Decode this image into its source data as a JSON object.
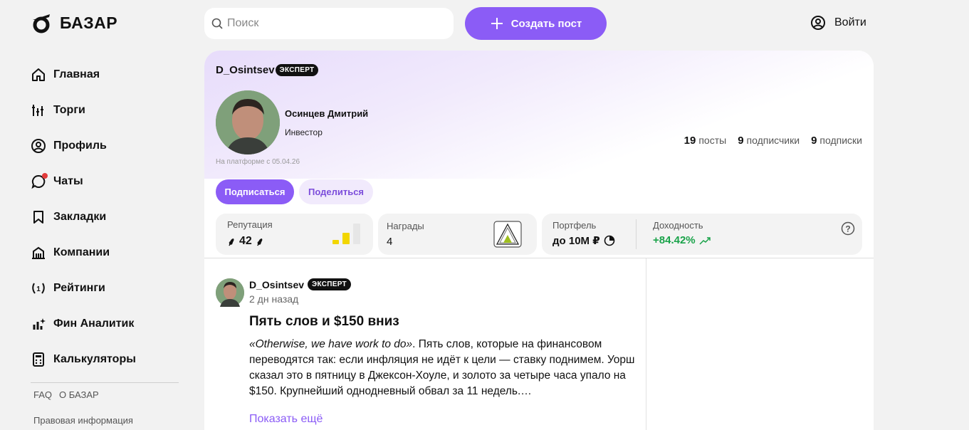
{
  "brand": {
    "name": "БАЗАР"
  },
  "nav": [
    {
      "label": "Главная",
      "icon": "home-icon"
    },
    {
      "label": "Торги",
      "icon": "trades-icon"
    },
    {
      "label": "Профиль",
      "icon": "user-icon"
    },
    {
      "label": "Чаты",
      "icon": "chat-icon"
    },
    {
      "label": "Закладки",
      "icon": "bookmark-icon"
    },
    {
      "label": "Компании",
      "icon": "building-icon"
    },
    {
      "label": "Рейтинги",
      "icon": "laurel-icon"
    },
    {
      "label": "Фин Аналитик",
      "icon": "analytics-icon"
    },
    {
      "label": "Калькуляторы",
      "icon": "calculator-icon"
    }
  ],
  "footer": {
    "faq": "FAQ",
    "about": "О БАЗАР",
    "legal": "Правовая информация"
  },
  "header": {
    "search_placeholder": "Поиск",
    "create_label": "Создать пост",
    "login_label": "Войти"
  },
  "profile": {
    "username": "D_Osintsev",
    "badge": "ЭКСПЕРТ",
    "full_name": "Осинцев Дмитрий",
    "role": "Инвестор",
    "since": "На платформе с 05.04.26",
    "stats": [
      {
        "num": "19",
        "label": "посты"
      },
      {
        "num": "9",
        "label": "подписчики"
      },
      {
        "num": "9",
        "label": "подписки"
      }
    ],
    "subscribe_label": "Подписаться",
    "share_label": "Поделиться",
    "reputation": {
      "title": "Репутация",
      "value": "42",
      "level": 2
    },
    "awards": {
      "title": "Награды",
      "value": "4"
    },
    "portfolio": {
      "title": "Портфель",
      "value": "до 10М ₽"
    },
    "yield": {
      "title": "Доходность",
      "value": "+84.42%"
    },
    "colors": {
      "accent": "#8b5cf6",
      "positive": "#1aa34a",
      "reputation_bar": "#f2d600"
    }
  },
  "post": {
    "username": "D_Osintsev",
    "badge": "ЭКСПЕРТ",
    "time": "2 дн назад",
    "title": "Пять слов и $150 вниз",
    "quote": "«Otherwise, we have work to do»",
    "text": ". Пять слов, которые на финансовом переводятся так: если инфляция не идёт к цели — ставку поднимем. Уорш сказал это в пятницу в Джексон-Хоуле, и золото за четыре часа упало на $150. Крупнейший однодневный обвал за 11 недель.…",
    "more_label": "Показать ещё"
  }
}
